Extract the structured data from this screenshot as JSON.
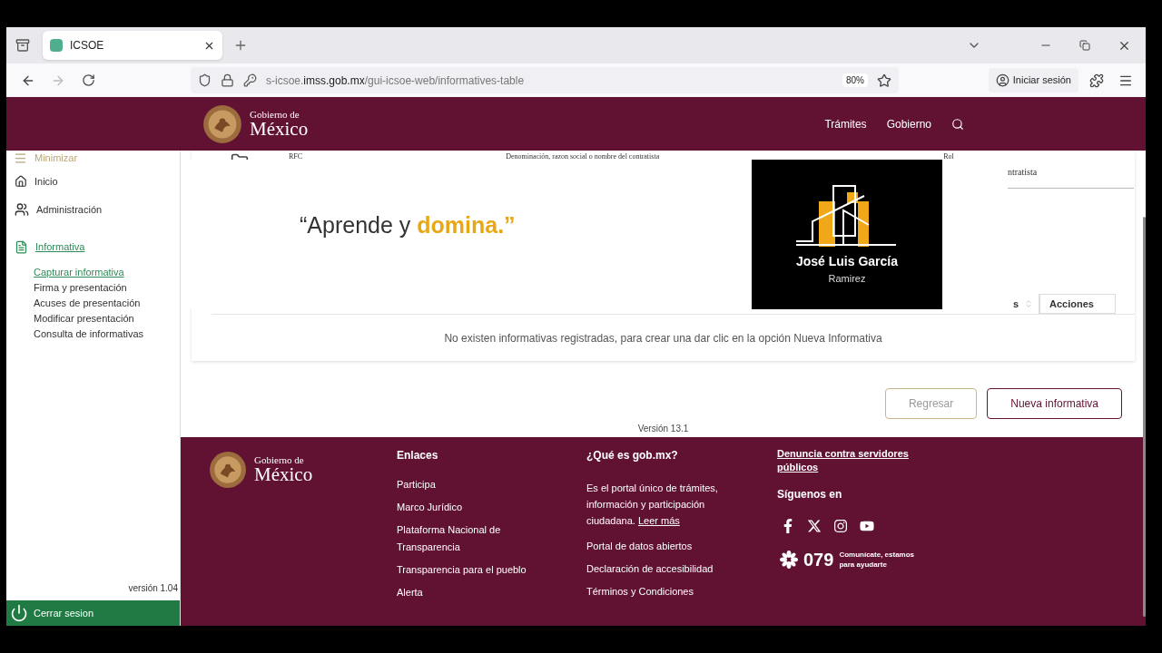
{
  "browser": {
    "tab_title": "ICSOE",
    "url": {
      "prefix": "s-icsoe.",
      "domain": "imss.gob.mx",
      "path": "/gui-icsoe-web/informatives-table"
    },
    "zoom": "80%",
    "sign_in": "Iniciar sesión"
  },
  "header": {
    "logo": {
      "line1": "Gobierno de",
      "line2": "México"
    },
    "nav": [
      "Trámites",
      "Gobierno"
    ]
  },
  "sidebar": {
    "minimize": "Minimizar",
    "items": [
      {
        "label": "Inicio",
        "kind": "home",
        "selected": false
      },
      {
        "label": "Administración",
        "kind": "users",
        "selected": false
      },
      {
        "label": "Informativa",
        "kind": "document",
        "selected": true,
        "children": [
          {
            "label": "Capturar informativa",
            "selected": true
          },
          {
            "label": "Firma y presentación",
            "selected": false
          },
          {
            "label": "Acuses de presentación",
            "selected": false
          },
          {
            "label": "Modificar presentación",
            "selected": false
          },
          {
            "label": "Consulta de informativas",
            "selected": false
          }
        ]
      }
    ],
    "version": "versión 1.04",
    "logout": "Cerrar sesion"
  },
  "table": {
    "hidden_headers": [
      "RFC",
      "Denominación, razon social o nombre del contratista",
      "Rol",
      "ntratista"
    ],
    "columns": [
      "s",
      "Acciones"
    ],
    "empty_message": "No existen informativas registradas, para crear una dar clic en la opción Nueva Informativa"
  },
  "overlay": {
    "quote": "“Aprende y ",
    "quote_highlight": "domina.”",
    "brand_name": "José Luis García",
    "brand_surname": "Ramirez"
  },
  "buttons": [
    {
      "label": "Regresar",
      "kind": "secondary"
    },
    {
      "label": "Nueva informativa",
      "kind": "primary"
    }
  ],
  "version": "Versión 13.1",
  "footer": {
    "logo": {
      "line1": "Gobierno de",
      "line2": "México"
    },
    "links_title": "Enlaces",
    "links": [
      "Participa",
      "Marco Jurídico",
      "Plataforma Nacional de Transparencia",
      "Transparencia para el pueblo",
      "Alerta"
    ],
    "about_title": "¿Qué es gob.mx?",
    "about_text": "Es el portal único de trámites, información y participación ciudadana.",
    "read_more": "Leer más",
    "about_links": [
      "Portal de datos abiertos",
      "Declaración de accesibilidad",
      "Términos y Condiciones"
    ],
    "complaint": "Denuncia contra servidores públicos",
    "follow_title": "Síguenos en",
    "phone": "079",
    "phone_text": "Comunícate, estamos para ayudarte"
  }
}
